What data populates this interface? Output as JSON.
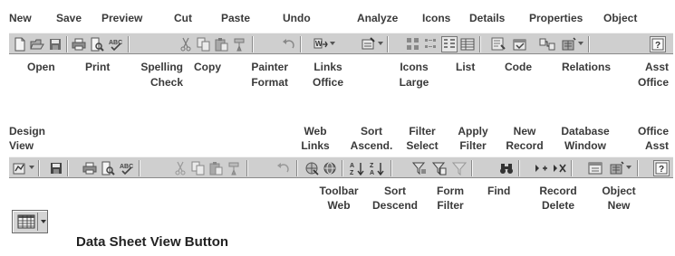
{
  "toolbar1": {
    "top_labels": {
      "new": "New",
      "save": "Save",
      "preview": "Preview",
      "cut": "Cut",
      "paste": "Paste",
      "undo": "Undo",
      "analyze": "Analyze",
      "icons": "Icons",
      "details": "Details",
      "properties": "Properties",
      "object": "Object"
    },
    "bottom_labels": {
      "open": "Open",
      "print": "Print",
      "spelling_1": "Spelling",
      "spelling_2": "Check",
      "copy": "Copy",
      "painter_1": "Painter",
      "painter_2": "Format",
      "links_1": "Links",
      "links_2": "Office",
      "icons_1": "Icons",
      "icons_2": "Large",
      "list": "List",
      "code": "Code",
      "relations": "Relations",
      "asst_1": "Asst",
      "asst_2": "Office"
    }
  },
  "toolbar2": {
    "top_labels": {
      "design_1": "Design",
      "design_2": "View",
      "web_1": "Web",
      "web_2": "Links",
      "sort_1": "Sort",
      "sort_2": "Ascend.",
      "filter_1": "Filter",
      "filter_2": "Select",
      "apply_1": "Apply",
      "apply_2": "Filter",
      "newrec_1": "New",
      "newrec_2": "Record",
      "db_1": "Database",
      "db_2": "Window",
      "oa_1": "Office",
      "oa_2": "Asst"
    },
    "bottom_labels": {
      "tbweb_1": "Toolbar",
      "tbweb_2": "Web",
      "sortd_1": "Sort",
      "sortd_2": "Descend",
      "form_1": "Form",
      "form_2": "Filter",
      "find": "Find",
      "recdel_1": "Record",
      "recdel_2": "Delete",
      "objnew_1": "Object",
      "objnew_2": "New"
    }
  },
  "datasheet": {
    "caption": "Data Sheet View Button"
  },
  "colors": {
    "toolbar_bg": "#cfcfcf",
    "label_text": "#3a3a3a"
  }
}
